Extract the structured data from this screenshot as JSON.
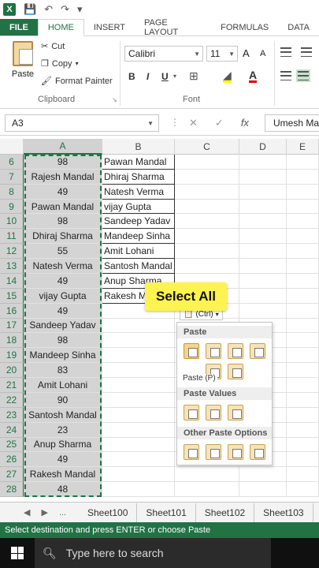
{
  "qat": {
    "logo": "X",
    "save_icon": "save-icon",
    "undo_icon": "undo-icon",
    "redo_icon": "redo-icon"
  },
  "tabs": [
    "FILE",
    "HOME",
    "INSERT",
    "PAGE LAYOUT",
    "FORMULAS",
    "DATA"
  ],
  "ribbon": {
    "paste_label": "Paste",
    "cut_label": "Cut",
    "copy_label": "Copy",
    "format_painter_label": "Format Painter",
    "clipboard_group": "Clipboard",
    "font_name": "Calibri",
    "font_size": "11",
    "font_group": "Font",
    "bold": "B",
    "italic": "I",
    "underline": "U",
    "grow_font": "A",
    "shrink_font": "A"
  },
  "formula_bar": {
    "name_box": "A3",
    "cancel": "✕",
    "enter": "✓",
    "fx": "fx",
    "content": "Umesh Ma"
  },
  "columns": [
    "A",
    "B",
    "C",
    "D",
    "E"
  ],
  "rows": [
    {
      "n": "6",
      "a": "98",
      "b": "Pawan Mandal"
    },
    {
      "n": "7",
      "a": "Rajesh Mandal",
      "b": "Dhiraj Sharma"
    },
    {
      "n": "8",
      "a": "49",
      "b": "Natesh Verma"
    },
    {
      "n": "9",
      "a": "Pawan Mandal",
      "b": "vijay Gupta"
    },
    {
      "n": "10",
      "a": "98",
      "b": "Sandeep Yadav"
    },
    {
      "n": "11",
      "a": "Dhiraj Sharma",
      "b": "Mandeep Sinha"
    },
    {
      "n": "12",
      "a": "55",
      "b": "Amit Lohani"
    },
    {
      "n": "13",
      "a": "Natesh Verma",
      "b": "Santosh Mandal"
    },
    {
      "n": "14",
      "a": "49",
      "b": "Anup Sharma"
    },
    {
      "n": "15",
      "a": "vijay Gupta",
      "b": "Rakesh M"
    },
    {
      "n": "16",
      "a": "49",
      "b": ""
    },
    {
      "n": "17",
      "a": "Sandeep Yadav",
      "b": ""
    },
    {
      "n": "18",
      "a": "98",
      "b": ""
    },
    {
      "n": "19",
      "a": "Mandeep Sinha",
      "b": ""
    },
    {
      "n": "20",
      "a": "83",
      "b": ""
    },
    {
      "n": "21",
      "a": "Amit Lohani",
      "b": ""
    },
    {
      "n": "22",
      "a": "90",
      "b": ""
    },
    {
      "n": "23",
      "a": "Santosh Mandal",
      "b": ""
    },
    {
      "n": "24",
      "a": "23",
      "b": ""
    },
    {
      "n": "25",
      "a": "Anup Sharma",
      "b": ""
    },
    {
      "n": "26",
      "a": "49",
      "b": ""
    },
    {
      "n": "27",
      "a": "Rakesh Mandal",
      "b": ""
    },
    {
      "n": "28",
      "a": "48",
      "b": ""
    }
  ],
  "paste_popup": {
    "ctrl_label": "(Ctrl)",
    "section_paste": "Paste",
    "section_values": "Paste Values",
    "section_other": "Other Paste Options",
    "tooltip": "Paste (P)"
  },
  "callout": "Select All",
  "sheet_tabs": [
    "Sheet100",
    "Sheet101",
    "Sheet102",
    "Sheet103"
  ],
  "sheet_more": "...",
  "status": "Select destination and press ENTER or choose Paste",
  "taskbar": {
    "search_placeholder": "Type here to search"
  },
  "colors": {
    "excel_green": "#217346",
    "callout_yellow": "#fff34f"
  }
}
